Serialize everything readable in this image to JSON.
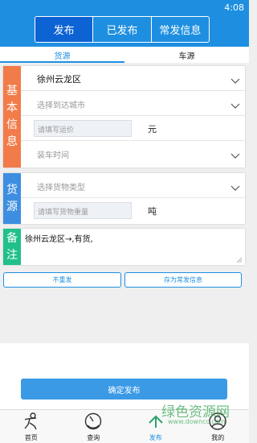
{
  "status_bar": {
    "time": "4:08"
  },
  "header": {
    "segments": [
      {
        "label": "发布",
        "active": true
      },
      {
        "label": "已发布",
        "active": false
      },
      {
        "label": "常发信息",
        "active": false
      }
    ]
  },
  "subtabs": [
    {
      "label": "货源",
      "active": true
    },
    {
      "label": "车源",
      "active": false
    }
  ],
  "basic_info": {
    "label_chars": [
      "基",
      "本",
      "信",
      "息"
    ],
    "color": "#f27b4a",
    "origin_value": "徐州云龙区",
    "destination_placeholder": "选择到达城市",
    "freight_placeholder": "请填写运价",
    "freight_unit": "元",
    "loading_time_placeholder": "装车时间"
  },
  "cargo": {
    "label_chars": [
      "货",
      "源"
    ],
    "color": "#3d8ee0",
    "type_placeholder": "选择货物类型",
    "weight_placeholder": "请填写货物重量",
    "weight_unit": "吨"
  },
  "remark": {
    "label_chars": [
      "备",
      "注"
    ],
    "color": "#21c08b",
    "value": "徐州云龙区→,有货,"
  },
  "actions": {
    "no_repeat_label": "不重发",
    "save_label": "存为常发信息",
    "confirm_label": "确定发布"
  },
  "tabbar": [
    {
      "label": "首页",
      "icon": "person-icon",
      "active": false
    },
    {
      "label": "查询",
      "icon": "gauge-icon",
      "active": false
    },
    {
      "label": "发布",
      "icon": "publish-icon",
      "active": true
    },
    {
      "label": "我的",
      "icon": "profile-icon",
      "active": false
    }
  ],
  "watermark": {
    "title": "绿色资源网",
    "url": "www.downcc.com"
  },
  "colors": {
    "primary": "#1e8fe0",
    "active_segment": "#0d63d4"
  }
}
